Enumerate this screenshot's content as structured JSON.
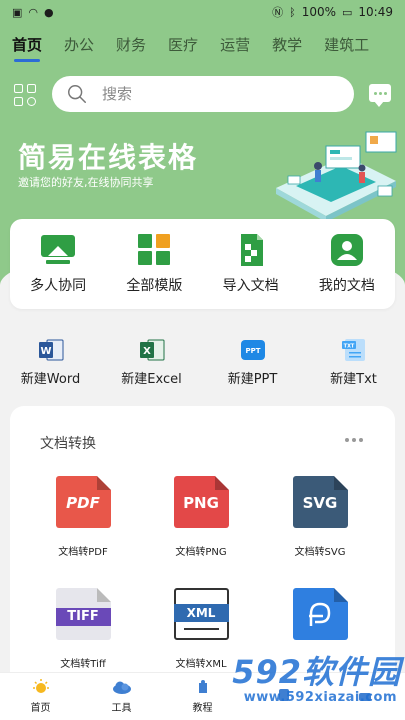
{
  "status_bar": {
    "battery": "100%",
    "time": "10:49"
  },
  "tabs": [
    "首页",
    "办公",
    "财务",
    "医疗",
    "运营",
    "教学",
    "建筑工"
  ],
  "search": {
    "placeholder": "搜索"
  },
  "banner": {
    "title": "简易在线表格",
    "subtitle": "邀请您的好友,在线协同共享"
  },
  "quick_actions": [
    {
      "label": "多人协同",
      "icon": "collab-icon",
      "color": "#2f9e44"
    },
    {
      "label": "全部模版",
      "icon": "templates-icon",
      "color": "#2f9e44"
    },
    {
      "label": "导入文档",
      "icon": "import-doc-icon",
      "color": "#2f9e44"
    },
    {
      "label": "我的文档",
      "icon": "my-docs-icon",
      "color": "#2f9e44"
    }
  ],
  "new_files": [
    {
      "label": "新建Word",
      "icon": "word-icon",
      "color": "#2b579a"
    },
    {
      "label": "新建Excel",
      "icon": "excel-icon",
      "color": "#217346"
    },
    {
      "label": "新建PPT",
      "icon": "ppt-icon",
      "color": "#1e88e5"
    },
    {
      "label": "新建Txt",
      "icon": "txt-icon",
      "color": "#42a5f5"
    }
  ],
  "conversion": {
    "title": "文档转换",
    "items": [
      {
        "label": "文档转PDF",
        "text": "PDF",
        "color": "#e8574a"
      },
      {
        "label": "文档转PNG",
        "text": "PNG",
        "color": "#e34848"
      },
      {
        "label": "文档转SVG",
        "text": "SVG",
        "color": "#3b5a78"
      },
      {
        "label": "文档转Tiff",
        "text": "TIFF",
        "color": "#6a49b8"
      },
      {
        "label": "文档转XML",
        "text": "XML",
        "color": "#2f6ab0"
      },
      {
        "label": "",
        "text": "",
        "color": "#2f7fe0"
      }
    ]
  },
  "bottom_nav": [
    {
      "label": "首页",
      "icon": "sun-icon"
    },
    {
      "label": "工具",
      "icon": "cloud-icon"
    },
    {
      "label": "教程",
      "icon": "book-icon"
    },
    {
      "label": "",
      "icon": "cube-icon"
    },
    {
      "label": "",
      "icon": "user-icon"
    }
  ],
  "watermark": {
    "brand": "592软件园",
    "url": "www.592xiazai.com"
  }
}
